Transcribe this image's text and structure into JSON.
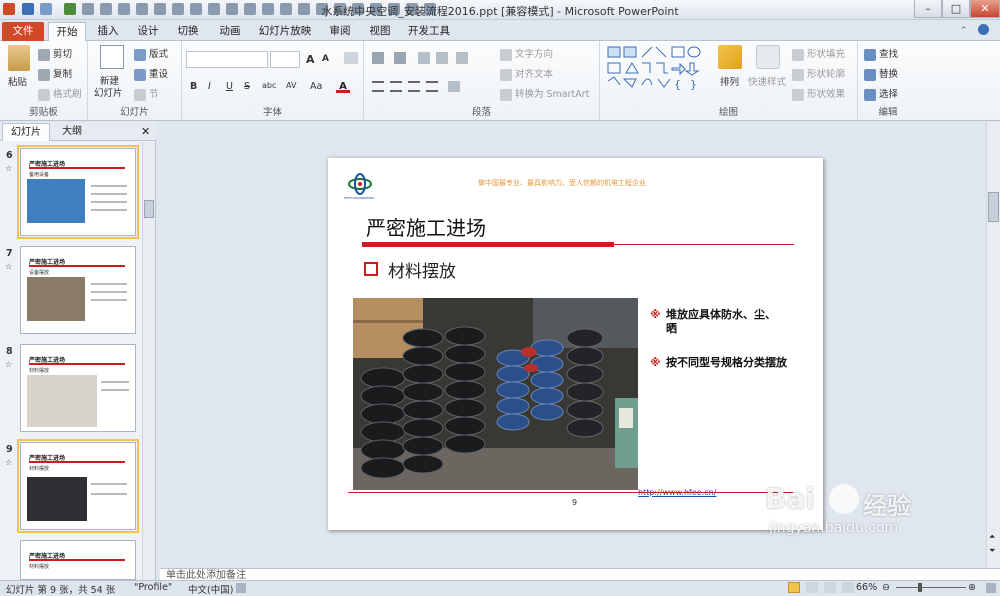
{
  "window": {
    "title": "水系统中央空调_安装流程2016.ppt [兼容模式] - Microsoft PowerPoint",
    "controls": {
      "minimize": "–",
      "maximize": "□",
      "close": "✕"
    }
  },
  "tabs": [
    "文件",
    "开始",
    "插入",
    "设计",
    "切换",
    "动画",
    "幻灯片放映",
    "审阅",
    "视图",
    "开发工具"
  ],
  "ribbon": {
    "clipboard": {
      "label": "剪贴板",
      "paste": "粘贴",
      "cut": "剪切",
      "copy": "复制",
      "format_painter": "格式刷"
    },
    "slides": {
      "label": "幻灯片",
      "new_slide": "新建",
      "new_slide2": "幻灯片",
      "layout": "版式",
      "reset": "重设",
      "section": "节"
    },
    "font": {
      "label": "字体",
      "bold": "B",
      "italic": "I",
      "underline": "U",
      "strike": "S",
      "shadow": "abc",
      "spacing": "AV",
      "case": "Aa",
      "grow": "A",
      "shrink": "A"
    },
    "paragraph": {
      "label": "段落",
      "text_direction": "文字方向",
      "align_text": "对齐文本",
      "smartart": "转换为 SmartArt"
    },
    "drawing": {
      "label": "绘图",
      "arrange": "排列",
      "quick_styles": "快速样式",
      "shape_fill": "形状填充",
      "shape_outline": "形状轮廓",
      "shape_effects": "形状效果"
    },
    "editing": {
      "label": "编辑",
      "find": "查找",
      "replace": "替换",
      "select": "选择"
    }
  },
  "panel": {
    "tab_slides": "幻灯片",
    "tab_outline": "大纲",
    "close": "✕",
    "thumbnails": [
      {
        "num": "6",
        "title": "严密施工进场",
        "sub": "备用设备"
      },
      {
        "num": "7",
        "title": "严密施工进场",
        "sub": "设备摆放"
      },
      {
        "num": "8",
        "title": "严密施工进场",
        "sub": "材料摆放"
      },
      {
        "num": "9",
        "title": "严密施工进场",
        "sub": "材料摆放"
      },
      {
        "num": "",
        "title": "严密施工进场",
        "sub": "材料摆放"
      }
    ]
  },
  "slide": {
    "tagline": "做中国最专业、最具影响力、受人信赖的机电工程企业",
    "logo_text": "HEFEI ENGINEERING",
    "title": "严密施工进场",
    "subtitle": "材料摆放",
    "bullets": [
      "堆放应具体防水、尘、晒",
      "按不同型号规格分类摆放"
    ],
    "bullet_marker": "※",
    "link": "http://www.hfee.cn/",
    "page_number": "9"
  },
  "notes": {
    "placeholder": "单击此处添加备注"
  },
  "status": {
    "slide_info": "幻灯片 第 9 张，共 54 张",
    "theme": "\"Profile\"",
    "language": "中文(中国)",
    "zoom": "66%"
  },
  "watermark": {
    "brand": "Bai",
    "brand2": "经验",
    "url": "jingyan.baidu.com"
  },
  "colors": {
    "accent_red": "#c81e1e",
    "file_tab": "#d24726",
    "selection": "#f3c44a",
    "tagline": "#e69538"
  }
}
